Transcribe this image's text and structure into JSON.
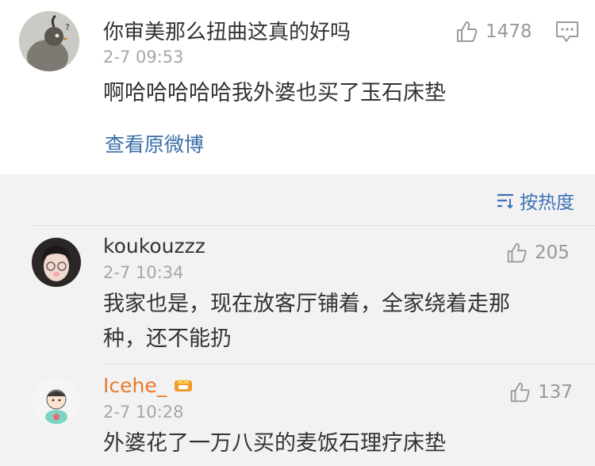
{
  "main_comment": {
    "text": "你审美那么扭曲这真的好吗",
    "time": "2-7 09:53",
    "likes": "1478",
    "reply": "啊哈哈哈哈哈我外婆也买了玉石床垫",
    "view_original": "查看原微博"
  },
  "sort_label": "按热度",
  "replies": [
    {
      "username": "koukouzzz",
      "time": "2-7 10:34",
      "likes": "205",
      "text_line1": "我家也是，现在放客厅铺着，全家绕着走那",
      "text_line2": "种，还不能扔"
    },
    {
      "username": "Icehe_",
      "time": "2-7 10:28",
      "likes": "137",
      "text_line1": "外婆花了一万八买的麦饭石理疗床垫",
      "username_color": "#e87a2d"
    }
  ],
  "colors": {
    "link": "#3a6ea8",
    "sort": "#3d72b8",
    "username_highlight": "#e87a2d"
  },
  "icons": [
    "thumb-up-icon",
    "comment-icon",
    "sort-icon",
    "vip-crown-icon"
  ]
}
